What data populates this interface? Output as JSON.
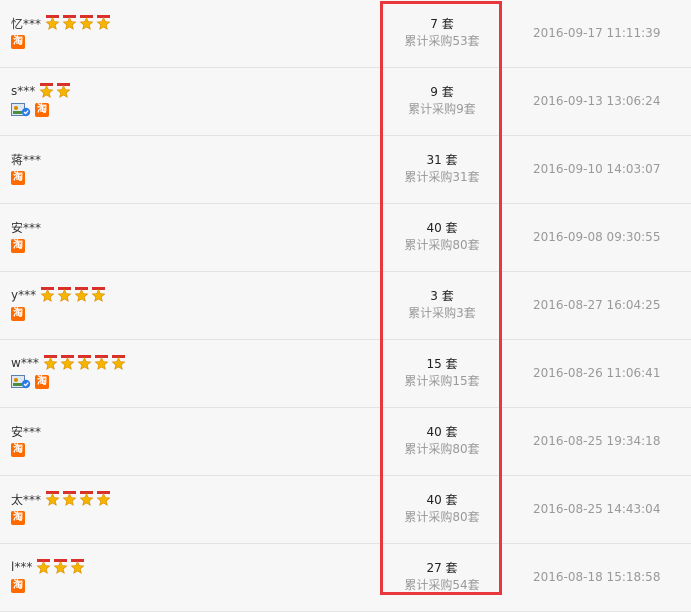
{
  "records": [
    {
      "buyer": "忆***",
      "stars": 4,
      "verified": false,
      "badge": "淘",
      "qty": "7 套",
      "total": "累计采购53套",
      "date": "2016-09-17 11:11:39"
    },
    {
      "buyer": "s***",
      "stars": 2,
      "verified": true,
      "badge": "淘",
      "qty": "9 套",
      "total": "累计采购9套",
      "date": "2016-09-13 13:06:24"
    },
    {
      "buyer": "蒋***",
      "stars": 0,
      "verified": false,
      "badge": "淘",
      "qty": "31 套",
      "total": "累计采购31套",
      "date": "2016-09-10 14:03:07"
    },
    {
      "buyer": "安***",
      "stars": 0,
      "verified": false,
      "badge": "淘",
      "qty": "40 套",
      "total": "累计采购80套",
      "date": "2016-09-08 09:30:55"
    },
    {
      "buyer": "y***",
      "stars": 4,
      "verified": false,
      "badge": "淘",
      "qty": "3 套",
      "total": "累计采购3套",
      "date": "2016-08-27 16:04:25"
    },
    {
      "buyer": "w***",
      "stars": 5,
      "verified": true,
      "badge": "淘",
      "qty": "15 套",
      "total": "累计采购15套",
      "date": "2016-08-26 11:06:41"
    },
    {
      "buyer": "安***",
      "stars": 0,
      "verified": false,
      "badge": "淘",
      "qty": "40 套",
      "total": "累计采购80套",
      "date": "2016-08-25 19:34:18"
    },
    {
      "buyer": "太***",
      "stars": 4,
      "verified": false,
      "badge": "淘",
      "qty": "40 套",
      "total": "累计采购80套",
      "date": "2016-08-25 14:43:04"
    },
    {
      "buyer": "l***",
      "stars": 3,
      "verified": false,
      "badge": "淘",
      "qty": "27 套",
      "total": "累计采购54套",
      "date": "2016-08-18 15:18:58"
    }
  ],
  "colors": {
    "highlight": "#e8383d",
    "badge": "#ff6a00",
    "star": "#f5b400"
  }
}
